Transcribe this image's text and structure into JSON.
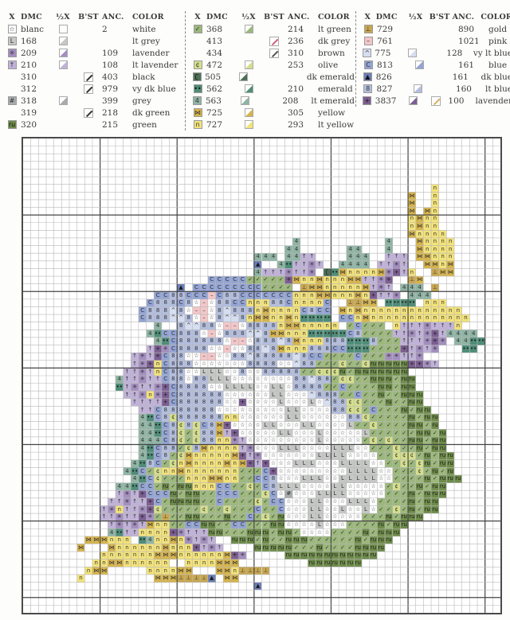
{
  "legend": {
    "headers": {
      "x": "X",
      "dmc": "DMC",
      "half_x": "½X",
      "backstitch": "B'ST",
      "anchor": "ANC.",
      "color": "COLOR"
    },
    "columns": [
      [
        {
          "code": "w",
          "symbol": "☆",
          "dmc": "blanc",
          "half": true,
          "bst": false,
          "anc": "2",
          "color": "white",
          "hex": "#ffffff"
        },
        {
          "code": "L",
          "symbol": "L",
          "dmc": "168",
          "half": true,
          "bst": false,
          "anc": "",
          "color": "lt grey",
          "hex": "#c6c8c6"
        },
        {
          "code": "*",
          "symbol": "✳",
          "dmc": "209",
          "half": true,
          "bst": false,
          "anc": "109",
          "color": "lavender",
          "hex": "#a48fc0"
        },
        {
          "code": "^",
          "symbol": "↑",
          "dmc": "210",
          "half": true,
          "bst": false,
          "anc": "108",
          "color": "lt lavender",
          "hex": "#c0b2d8"
        },
        {
          "code": "",
          "symbol": "",
          "dmc": "310",
          "half": false,
          "bst": true,
          "bst_hex": "#333333",
          "anc": "403",
          "color": "black",
          "hex": ""
        },
        {
          "code": "",
          "symbol": "",
          "dmc": "312",
          "half": false,
          "bst": true,
          "bst_hex": "#333333",
          "anc": "979",
          "color": "vy dk blue",
          "hex": ""
        },
        {
          "code": "#",
          "symbol": "#",
          "dmc": "318",
          "half": true,
          "bst": false,
          "anc": "399",
          "color": "grey",
          "hex": "#a8abad"
        },
        {
          "code": "",
          "symbol": "",
          "dmc": "319",
          "half": false,
          "bst": true,
          "bst_hex": "#333333",
          "anc": "218",
          "color": "dk green",
          "hex": ""
        },
        {
          "code": "v",
          "symbol": "ru",
          "dmc": "320",
          "half": false,
          "bst": false,
          "anc": "215",
          "color": "green",
          "hex": "#6e8c4a"
        }
      ],
      [
        {
          "code": "k",
          "symbol": "✓",
          "dmc": "368",
          "half": true,
          "bst": false,
          "anc": "214",
          "color": "lt green",
          "hex": "#9cb87c"
        },
        {
          "code": "",
          "symbol": "",
          "dmc": "413",
          "half": false,
          "bst": true,
          "bst_hex": "#d0607a",
          "anc": "236",
          "color": "dk grey",
          "hex": ""
        },
        {
          "code": "",
          "symbol": "",
          "dmc": "434",
          "half": false,
          "bst": true,
          "bst_hex": "#555555",
          "anc": "310",
          "color": "brown",
          "hex": ""
        },
        {
          "code": "c",
          "symbol": "¢",
          "dmc": "472",
          "half": true,
          "bst": false,
          "anc": "253",
          "color": "olive",
          "hex": "#d5df8c"
        },
        {
          "code": "e",
          "symbol": "ʗ",
          "dmc": "505",
          "half": true,
          "bst": false,
          "anc": "",
          "color": "dk emerald",
          "hex": "#4f7058"
        },
        {
          "code": "m",
          "symbol": "••",
          "dmc": "562",
          "half": true,
          "bst": false,
          "anc": "210",
          "color": "emerald",
          "hex": "#4f8d78"
        },
        {
          "code": "4",
          "symbol": "4",
          "dmc": "563",
          "half": true,
          "bst": false,
          "anc": "208",
          "color": "lt emerald",
          "hex": "#8fb4a4"
        },
        {
          "code": "x",
          "symbol": "⋈",
          "dmc": "725",
          "half": true,
          "bst": false,
          "anc": "305",
          "color": "yellow",
          "hex": "#d6b44c"
        },
        {
          "code": "n",
          "symbol": "n",
          "dmc": "727",
          "half": true,
          "bst": false,
          "anc": "293",
          "color": "lt yellow",
          "hex": "#f2e27a"
        }
      ],
      [
        {
          "code": "g",
          "symbol": "⊥",
          "dmc": "729",
          "half": false,
          "bst": false,
          "anc": "890",
          "color": "gold",
          "hex": "#c8a650"
        },
        {
          "code": "-",
          "symbol": "–",
          "dmc": "761",
          "half": false,
          "bst": false,
          "anc": "1021",
          "color": "pink",
          "hex": "#f2c6c8"
        },
        {
          "code": "a",
          "symbol": "^",
          "dmc": "775",
          "half": true,
          "bst": false,
          "anc": "128",
          "color": "vy lt blue",
          "hex": "#d6def0"
        },
        {
          "code": "C",
          "symbol": "C",
          "dmc": "813",
          "half": true,
          "bst": false,
          "anc": "161",
          "color": "blue",
          "hex": "#93a4d4"
        },
        {
          "code": "t",
          "symbol": "▲",
          "dmc": "826",
          "half": false,
          "bst": false,
          "anc": "161",
          "color": "dk blue",
          "hex": "#6d7fb6"
        },
        {
          "code": "8",
          "symbol": "8",
          "dmc": "827",
          "half": true,
          "bst": false,
          "anc": "160",
          "color": "lt blue",
          "hex": "#b3bede"
        },
        {
          "code": "+",
          "symbol": "+",
          "dmc": "3837",
          "half": true,
          "bst": true,
          "bst_hex": "#d4b060",
          "anc": "100",
          "color": "lavender",
          "hex": "#7c5f92"
        }
      ]
    ]
  },
  "chart": {
    "cols": 62,
    "rows": 62,
    "major_every": 10,
    "pattern": [
      "..............................................................",
      "..............................................................",
      "..............................................................",
      "..............................................................",
      "..............................................................",
      "..............................................................",
      ".....................................................n........",
      "..................................................x..n........",
      "..................................................x..n........",
      "..................................................x.xn........",
      "..................................................nxnn........",
      "..................................................nxnn........",
      "..................................................xnnnn.......",
      "...................................4...........4...xnnnn......",
      "..................................44......44...4...xnnnn......",
      "..............................444.44^^....444..^^^.xxnnn......",
      "..............................t..4m^^*^..4444.^^*^..xxnx.......",
      "..............................4^^^*^^*.emxnnnnx*+^n..gxx.......",
      "........................CCCCCkkkkk+xnnxnnnxx^^*+..gx.........",
      "....................t.CCCCCCCCCkkkk.gxxnnnnnx^*^.444.g.......",
      ".................CC88CCC-C88CCCCCCCnnnxxnnnxn+^^*.444.......",
      "................C888C8w-w88CCnnn88CnnnnC..ggxx.mmmm.nnn.......",
      "...............C888a8w--w8a888nxnnnnC8CC.xnxnnnnnnnnnnnnn.....",
      "...............C888aa8w-w8aa8nxxnnxnmmmm.CCnxnnnnnnnnnnnnn....",
      ".................4..8aa88w--w8888nxxnnnnn.kCkkk.n^^^*^^^n...",
      "................4mCC888w-w888aa8xxnnnmmmmmC8kkkk^^*^*+^4444..",
      ".................4mC888888w--w888a8xnnn888mmm8kkk^^^*+*.44mm..",
      "................^+*C8888ww-ww88a8xnnn888CCmmmkkkk+^*^*...mm..",
      "..............^*^+C88ww--ww88a88888a8CCkkkkCkkk**^^*.....",
      "..............^*+nC888wwwwwww8888wwa88kkkckkcvvvvv++*^....",
      ".............^^*^nC88wwLLLww8ww88888kkcccvkvvvvvvv........",
      "............4^^*^^C88w88LLLwwwwwwww88a88kcckkvvvkvv.......",
      "............m^*^^*+C8888wwLLLLwwLLw8888kkCkkkkvvkvv.......",
      ".............^^*n*+C888888wwwwwwLLwwwa888kkCkkvkkvvv......",
      "..............^^^^+C888888ww+wwwwLwwwLwa88cckkkvkkvv......",
      "...............^^C8888888wwwwwwwwwLLwwww88cckCkkkvkvv.....",
      "...............4mC8c888888nnwwwwwwLLwwwwww88ckkkkkvkvv....",
      "...............44mC8c8cC8x+wwwwLLwwwLLwwwwLkkckkkkvvkv....",
      "...............44mC8ckc88x^+wwwwwLLwwwLwwwwwLkkkkkkvvkv...",
      "...............444C8ckc88nn*^wwwwwwwwwLwwwwwkckckkvvkvv...",
      "...............4mC88kc8xnnnn^*wwwLLLwwwwLLLwwkkkckkvkvv...",
      "...............4mC8kcxnnnnnx+^*wwwwwwwLLLLwwwwkkccckvkvv..",
      "..............4m8Ckcnxnnnnxnx+^+wwwLLLwwwLLLLwwkkckcvkvv..",
      ".............4mCkcnnxnnnnnnnkkkC+wwwwwwwwwLLLLwwkkkckvkv..",
      "..............4mCckkknnnxxnnkkCC8wwwLLLwwLLLLLwwkkkkvkvvv..",
      "............44mCCkvkvvnnnCCkkckC8LLLwwwwLLwwwwwkckkvkvv...",
      "............^*^+CCCvkvvkkCCCkkkcCw#wwwLLLLwwwwwkkkvkvvv...",
      "...........^^*^^+CkvvvvkkCkkkkckCCwwwLLwwwLLLwkkkkvkvv....",
      "..........^*n^^*+ckkkkkckkckkkCkkCwwwLLwwLwwLwkkckvkvv....",
      "..........^^*^^+*kgkkvvkkkvkkCkckvwwwLLwwwwwkkkvkvvv.....",
      "...........^*^*^xnnkkCCvvkkCCkkkvvwwwwLwwwkkkkvkvv.......",
      "...........4m^^nnnn+*^^^vvkkkvvvkvvkwwwwkkkkvkvvv........",
      "........xxxnnn.m4nnxn*^*^..vvvkvkkvvvkkkkkkvkvvv.........",
      ".......x...xnnnnnnxnnn+^*^....vvvvvkkkvkkkkvvvv..........",
      "..........nnnnnnnxxxnnnnnnx+*.....vvvvvvvvvvvv...........",
      ".........nnxxnnnnnn..nnnnxxx.........vvvvvvv.............",
      "........nxx.....nnnnxx...xxngggg.........................",
      ".......n.........xxxggggt.xx.............................",
      "..............................t..........................",
      "..............................................................",
      "..............................................................",
      ".............................................................."
    ]
  }
}
